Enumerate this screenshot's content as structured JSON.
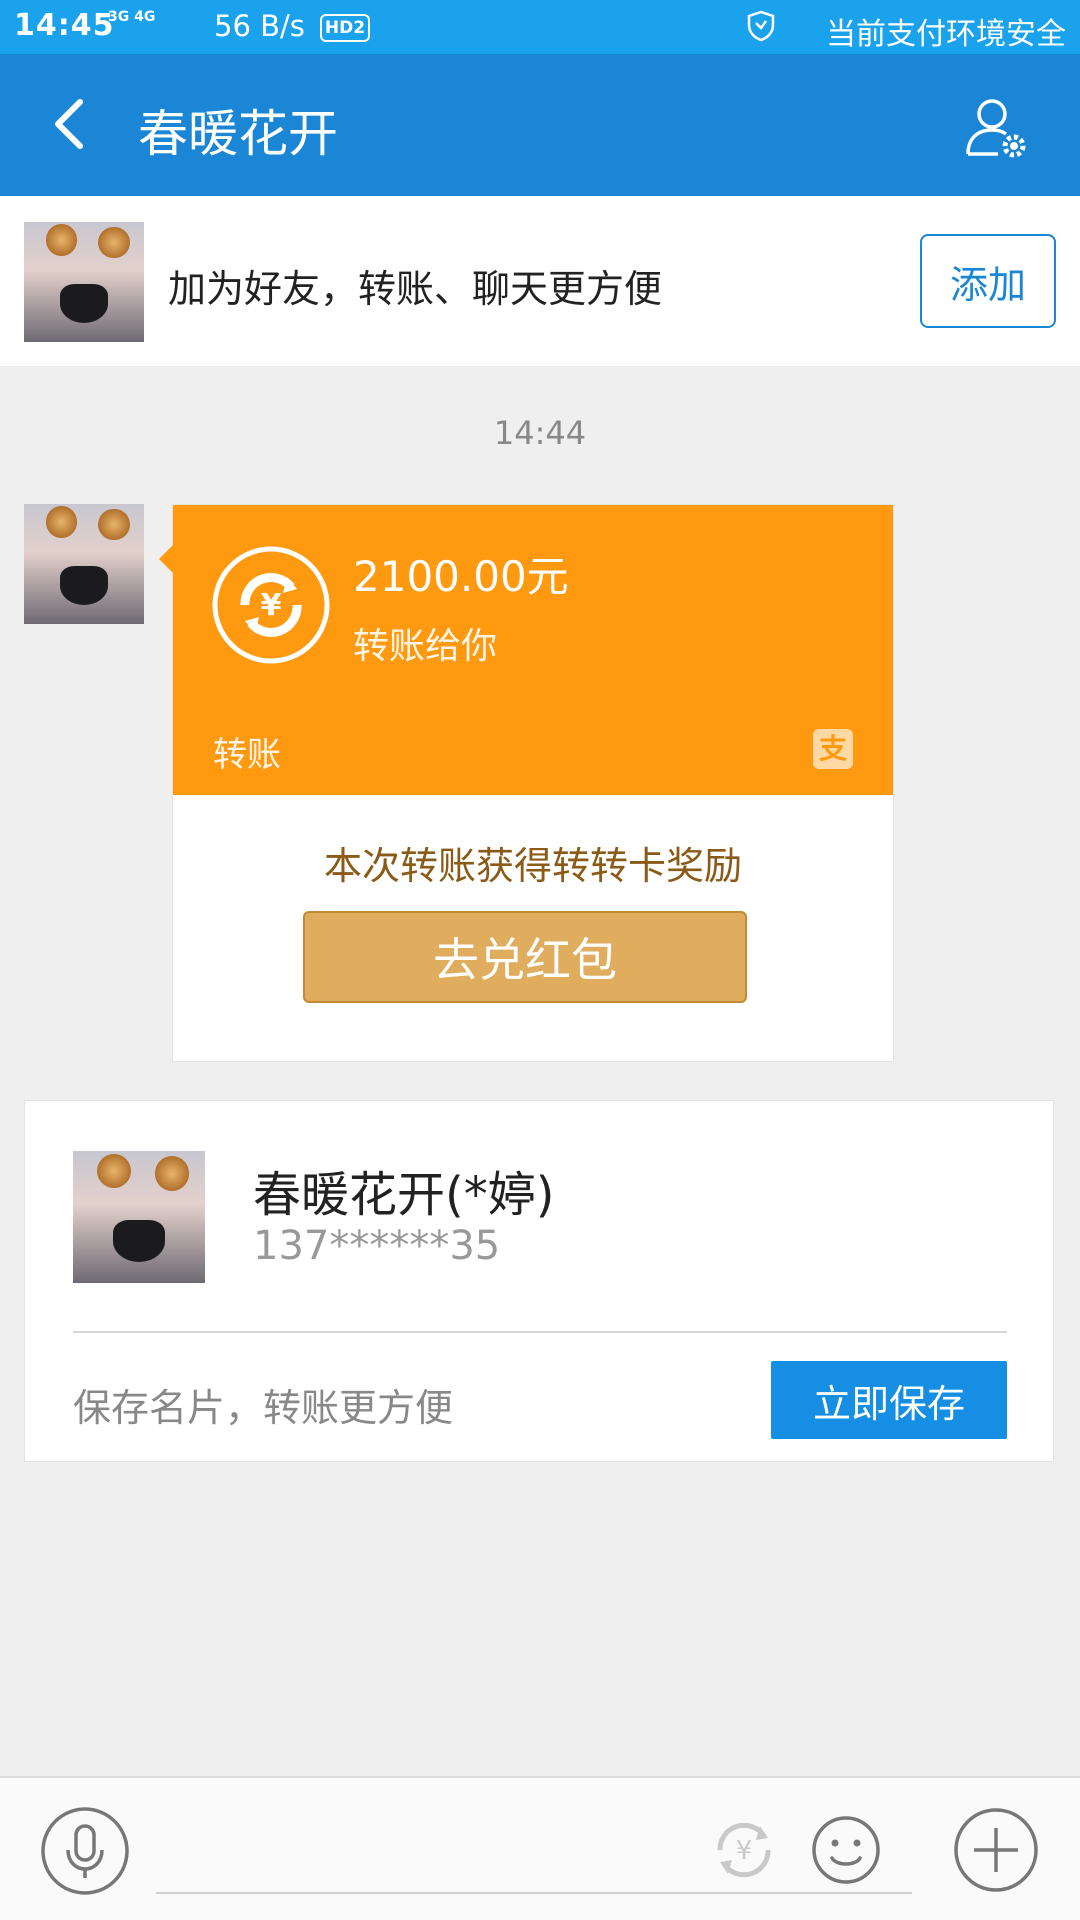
{
  "status_bar": {
    "time": "14:45",
    "network": "3G 4G",
    "speed": "56 B/s",
    "hd_badge": "HD2",
    "security_text": "当前支付环境安全"
  },
  "nav": {
    "title": "春暖花开"
  },
  "friend_bar": {
    "text": "加为好友，转账、聊天更方便",
    "add_button": "添加"
  },
  "chat": {
    "timestamp": "14:44",
    "transfer": {
      "amount": "2100.00元",
      "description": "转账给你",
      "kind": "转账",
      "alipay_icon_text": "支",
      "reward_text": "本次转账获得转转卡奖励",
      "redeem_button": "去兑红包"
    }
  },
  "contact_card": {
    "name": "春暖花开(*婷)",
    "phone": "137******35",
    "hint": "保存名片，转账更方便",
    "save_button": "立即保存"
  },
  "colors": {
    "status_bar": "#1aa2ec",
    "nav_bar": "#1b86d6",
    "transfer_orange": "#ff990f",
    "redeem_gold": "#e0ad5e",
    "save_blue": "#168ee4"
  }
}
